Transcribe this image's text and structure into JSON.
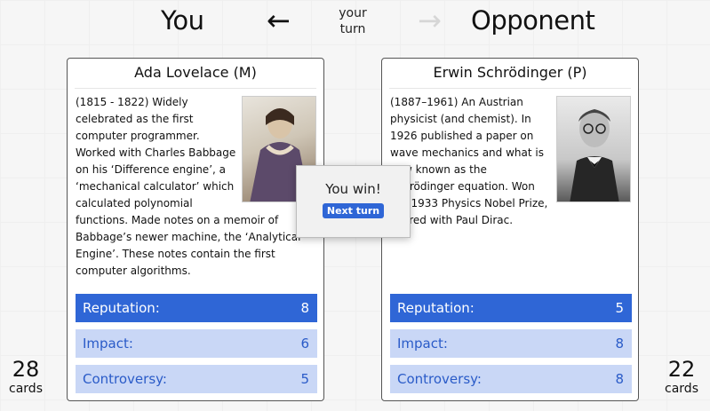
{
  "header": {
    "you_label": "You",
    "opponent_label": "Opponent",
    "turn_text": "your turn",
    "arrow_left": "←",
    "arrow_right": "→"
  },
  "player_card": {
    "title": "Ada Lovelace (M)",
    "portrait": "ada-lovelace-portrait",
    "description": "(1815 - 1822) Widely celebrated as the first computer programmer. Worked with Charles Babbage on his ‘Difference engine’, a ‘mechanical calculator’ which calculated polynomial functions. Made notes on a memoir of Babbage’s newer machine, the ‘Analytical Engine’. These notes contain the first computer algorithms.",
    "stats": [
      {
        "label": "Reputation:",
        "value": "8",
        "selected": true
      },
      {
        "label": "Impact:",
        "value": "6",
        "selected": false
      },
      {
        "label": "Controversy:",
        "value": "5",
        "selected": false
      }
    ]
  },
  "opponent_card": {
    "title": "Erwin Schrödinger (P)",
    "portrait": "erwin-schrodinger-portrait",
    "description": "(1887–1961) An Austrian physicist (and chemist). In 1926 published a paper on wave mechanics and what is now known as the Schrödinger equation. Won the 1933 Physics Nobel Prize, shared with Paul Dirac.",
    "stats": [
      {
        "label": "Reputation:",
        "value": "5",
        "selected": true
      },
      {
        "label": "Impact:",
        "value": "8",
        "selected": false
      },
      {
        "label": "Controversy:",
        "value": "8",
        "selected": false
      }
    ]
  },
  "decks": {
    "player_count": "28",
    "player_label": "cards",
    "opponent_count": "22",
    "opponent_label": "cards"
  },
  "result": {
    "message": "You win!",
    "button_label": "Next turn"
  },
  "colors": {
    "accent": "#2f66d6",
    "stat_inactive_bg": "#c9d7f6",
    "stat_inactive_text": "#2a5bc8"
  }
}
